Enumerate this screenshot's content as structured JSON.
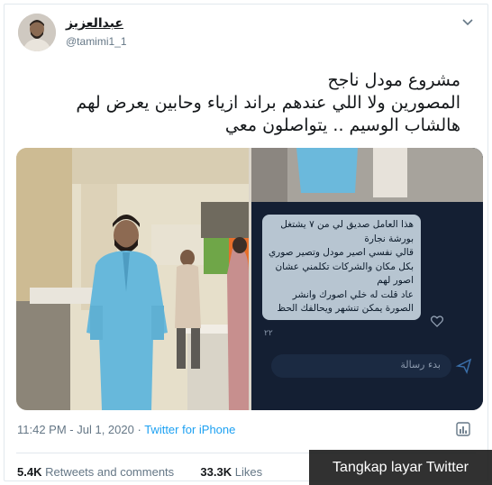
{
  "tweet": {
    "author": {
      "display_name": "عبدالعزيز",
      "handle": "@tamimi1_1"
    },
    "menu_icon": "chevron-down-icon",
    "text_lines": [
      "مشروع مودل ناجح",
      "المصورين ولا اللي عندهم براند ازياء وحابين يعرض لهم",
      "هالشاب الوسيم .. يتواصلون معي"
    ],
    "media": {
      "chat_bubble_lines": [
        "هذا العامل صديق لي من ٧ يشتغل",
        "بورشة نجارة",
        "قالي نفسي اصير مودل وتصير صوري",
        "بكل مكان والشركات تكلمني عشان",
        "اصور لهم",
        "عاد قلت له خلي اصورك وانشر",
        "الصورة يمكن تنشهر ويحالفك الحظ"
      ],
      "chat_time": "٢٢",
      "reply_placeholder": "بدء رسالة"
    },
    "timestamp": "11:42 PM - Jul 1, 2020",
    "separator": "·",
    "source": "Twitter for iPhone",
    "stats": {
      "retweets_count": "5.4K",
      "retweets_label": "Retweets and comments",
      "likes_count": "33.3K",
      "likes_label": "Likes"
    }
  },
  "caption": "Tangkap layar Twitter",
  "colors": {
    "link": "#1da1f2",
    "secondary_text": "#657786",
    "chat_bg": "#141f33",
    "bubble": "#b7c5d1"
  }
}
